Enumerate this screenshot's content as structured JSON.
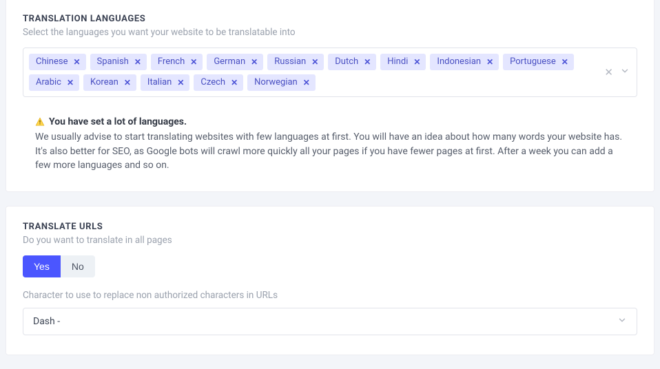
{
  "langs": {
    "title": "TRANSLATION LANGUAGES",
    "subtitle": "Select the languages you want your website to be translatable into",
    "items": [
      "Chinese",
      "Spanish",
      "French",
      "German",
      "Russian",
      "Dutch",
      "Hindi",
      "Indonesian",
      "Portuguese",
      "Arabic",
      "Korean",
      "Italian",
      "Czech",
      "Norwegian"
    ],
    "warning_title": "You have set a lot of languages.",
    "warning_body": "We usually advise to start translating websites with few languages at first. You will have an idea about how many words your website has. It's also better for SEO, as Google bots will crawl more quickly all your pages if you have fewer pages at first. After a week you can add a few more languages and so on."
  },
  "urls": {
    "title": "TRANSLATE URLS",
    "subtitle": "Do you want to translate in all pages",
    "yes": "Yes",
    "no": "No",
    "char_label": "Character to use to replace non authorized characters in URLs",
    "selected": "Dash -"
  }
}
